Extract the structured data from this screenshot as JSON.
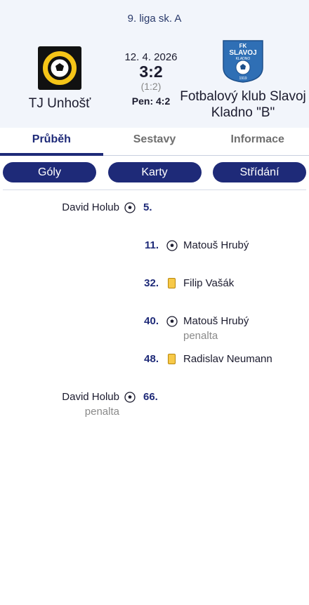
{
  "match": {
    "league": "9. liga sk. A",
    "date": "12. 4. 2026",
    "score": "3:2",
    "halftime": "(1:2)",
    "penalty": "Pen: 4:2",
    "home": {
      "name": "TJ Unhošť",
      "logo_icon": "tj-unhost-badge"
    },
    "away": {
      "name": "Fotbalový klub Slavoj Kladno \"B\"",
      "logo_icon": "fk-slavoj-kladno-shield",
      "logo_text_top": "FK",
      "logo_text_mid": "SLAVOJ",
      "logo_text_small": "KLADNO",
      "logo_year": "1919"
    }
  },
  "tabs": [
    {
      "label": "Průběh",
      "active": true
    },
    {
      "label": "Sestavy",
      "active": false
    },
    {
      "label": "Informace",
      "active": false
    }
  ],
  "filters": [
    {
      "label": "Góly"
    },
    {
      "label": "Karty"
    },
    {
      "label": "Střídání"
    }
  ],
  "events": [
    {
      "side": "home",
      "minute": "5.",
      "type": "goal",
      "player": "David Holub",
      "note": ""
    },
    {
      "side": "away",
      "minute": "11.",
      "type": "goal",
      "player": "Matouš Hrubý",
      "note": ""
    },
    {
      "side": "away",
      "minute": "32.",
      "type": "yellow-card",
      "player": "Filip Vašák",
      "note": ""
    },
    {
      "side": "away",
      "minute": "40.",
      "type": "goal",
      "player": "Matouš Hrubý",
      "note": "penalta"
    },
    {
      "side": "away",
      "minute": "48.",
      "type": "yellow-card",
      "player": "Radislav Neumann",
      "note": ""
    },
    {
      "side": "home",
      "minute": "66.",
      "type": "goal",
      "player": "David Holub",
      "note": "penalta"
    }
  ],
  "colors": {
    "accent": "#1e2a78",
    "header_bg": "#f2f5fb",
    "yellow_card": "#f7c948"
  }
}
